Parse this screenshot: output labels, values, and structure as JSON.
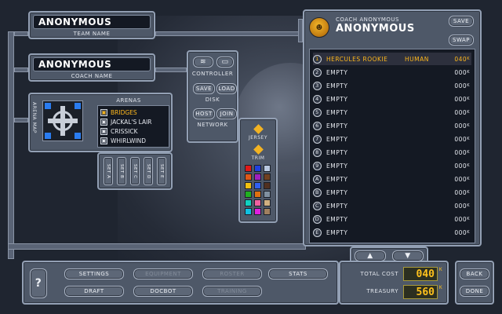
{
  "team": {
    "name": "ANONYMOUS",
    "label": "TEAM NAME"
  },
  "coach": {
    "name": "ANONYMOUS",
    "label": "COACH NAME"
  },
  "controller": {
    "label": "CONTROLLER",
    "disk_label": "DISK",
    "save": "SAVE",
    "load": "LOAD",
    "network_label": "NETWORK",
    "host": "HOST",
    "join": "JOIN"
  },
  "arenas": {
    "title": "ARENAS",
    "map_label": "ARENA MAP",
    "items": [
      {
        "name": "BRIDGES",
        "selected": true
      },
      {
        "name": "JACKAL'S LAIR",
        "selected": false
      },
      {
        "name": "CRISSICK",
        "selected": false
      },
      {
        "name": "WHIRLWIND",
        "selected": false
      }
    ],
    "sets": [
      "SET A",
      "SET B",
      "SET C",
      "SET D",
      "SET E"
    ]
  },
  "kit": {
    "jersey_label": "JERSEY",
    "trim_label": "TRIM",
    "palette": [
      "#e01818",
      "#2040e0",
      "#b8c8e0",
      "#e05818",
      "#a020c0",
      "#704020",
      "#f0c010",
      "#3060f0",
      "#503020",
      "#20b020",
      "#e07010",
      "#8090a0",
      "#10d0c0",
      "#f060a0",
      "#d0b080",
      "#10c0e0",
      "#e020e0",
      "#a08060"
    ]
  },
  "roster": {
    "coach_label": "COACH ANONYMOUS",
    "coach_name": "ANONYMOUS",
    "save": "SAVE",
    "swap": "SWAP",
    "players": [
      {
        "num": "1",
        "name": "HERCULES ROOKIE",
        "race": "HUMAN",
        "cost": "040",
        "highlight": true
      },
      {
        "num": "2",
        "name": "EMPTY",
        "race": "",
        "cost": "000",
        "highlight": false
      },
      {
        "num": "3",
        "name": "EMPTY",
        "race": "",
        "cost": "000",
        "highlight": false
      },
      {
        "num": "4",
        "name": "EMPTY",
        "race": "",
        "cost": "000",
        "highlight": false
      },
      {
        "num": "5",
        "name": "EMPTY",
        "race": "",
        "cost": "000",
        "highlight": false
      },
      {
        "num": "6",
        "name": "EMPTY",
        "race": "",
        "cost": "000",
        "highlight": false
      },
      {
        "num": "7",
        "name": "EMPTY",
        "race": "",
        "cost": "000",
        "highlight": false
      },
      {
        "num": "8",
        "name": "EMPTY",
        "race": "",
        "cost": "000",
        "highlight": false
      },
      {
        "num": "9",
        "name": "EMPTY",
        "race": "",
        "cost": "000",
        "highlight": false
      },
      {
        "num": "A",
        "name": "EMPTY",
        "race": "",
        "cost": "000",
        "highlight": false
      },
      {
        "num": "B",
        "name": "EMPTY",
        "race": "",
        "cost": "000",
        "highlight": false
      },
      {
        "num": "C",
        "name": "EMPTY",
        "race": "",
        "cost": "000",
        "highlight": false
      },
      {
        "num": "D",
        "name": "EMPTY",
        "race": "",
        "cost": "000",
        "highlight": false
      },
      {
        "num": "E",
        "name": "EMPTY",
        "race": "",
        "cost": "000",
        "highlight": false
      }
    ],
    "cost_suffix": "K"
  },
  "totals": {
    "total_label": "TOTAL COST",
    "total_value": "040",
    "treasury_label": "TREASURY",
    "treasury_value": "560",
    "suffix": "K"
  },
  "nav": {
    "help": "?",
    "settings": "SETTINGS",
    "equipment": "EQUIPMENT",
    "roster": "ROSTER",
    "stats": "STATS",
    "draft": "DRAFT",
    "docbot": "DOCBOT",
    "training": "TRAINING",
    "back": "BACK",
    "done": "DONE"
  }
}
